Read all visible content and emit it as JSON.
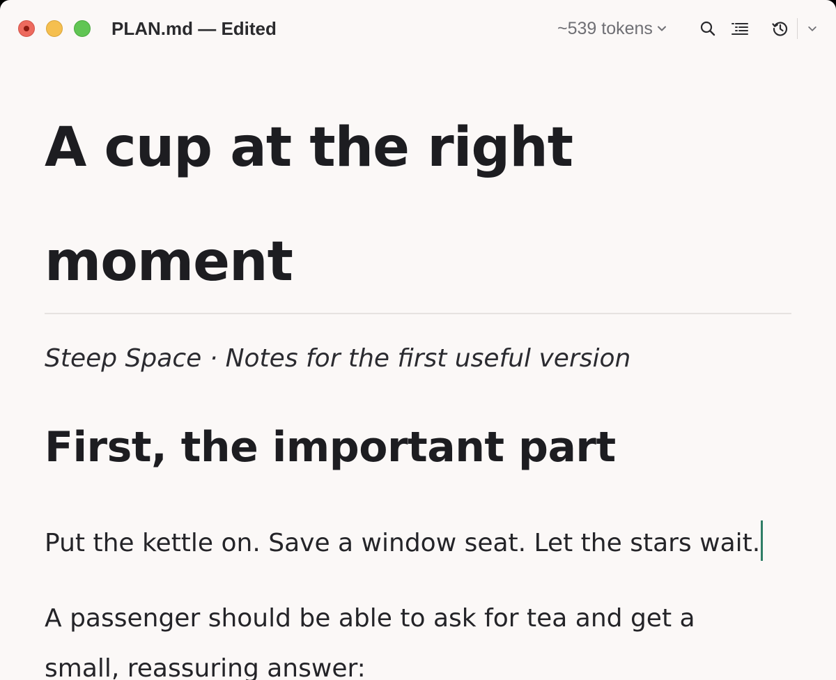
{
  "window": {
    "title": "PLAN.md — Edited"
  },
  "toolbar": {
    "tokens_label": "~539 tokens",
    "icons": [
      "search-icon",
      "outline-list-icon",
      "history-icon",
      "chevron-down-icon"
    ]
  },
  "document": {
    "heading_line1": "A cup at the right",
    "heading_line2": "moment",
    "subtitle": "Steep Space · Notes for the first useful version",
    "section_heading": "First, the important part",
    "paragraph1": "Put the kettle on. Save a window seat. Let the stars wait.",
    "paragraph2_line1": "A passenger should be able to ask for tea and get a",
    "paragraph2_line2": "small, reassuring answer:"
  },
  "colors": {
    "background": "#fbf8f7",
    "text": "#1d1d21",
    "caret": "#2f7d66",
    "close": "#ed6a5e",
    "minimize": "#f5bf4f",
    "zoom": "#61c554"
  }
}
